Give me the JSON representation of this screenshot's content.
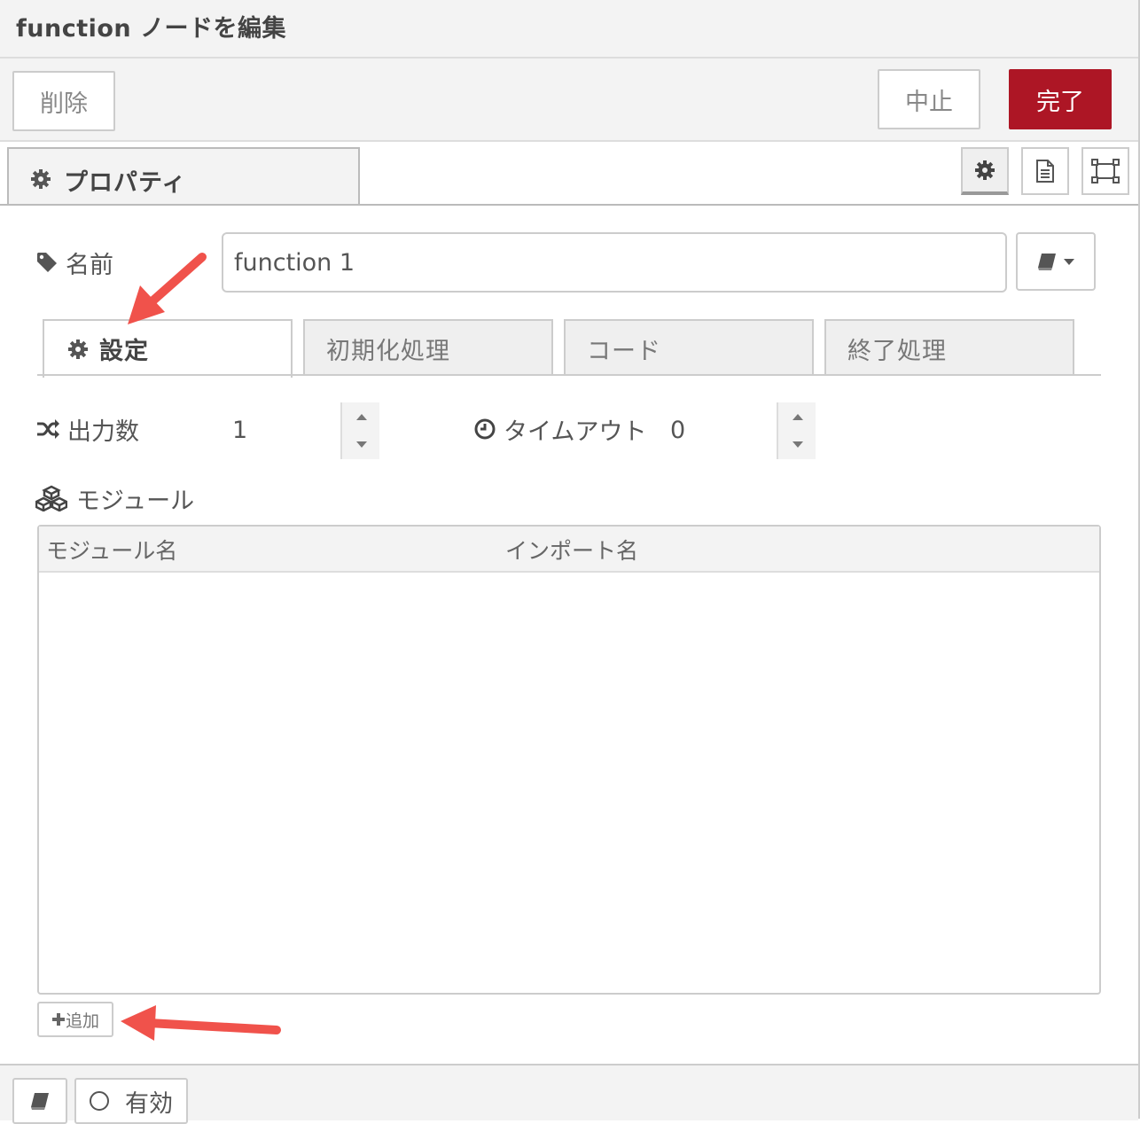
{
  "dialog": {
    "title": "function ノードを編集",
    "buttons": {
      "delete": "削除",
      "cancel": "中止",
      "done": "完了"
    }
  },
  "tray": {
    "tab_label": "プロパティ",
    "icons": [
      "gear-icon",
      "document-icon",
      "expand-icon"
    ]
  },
  "name_field": {
    "label": "名前",
    "value": "function 1"
  },
  "tabs": {
    "settings": "設定",
    "setup": "初期化処理",
    "code": "コード",
    "cleanup": "終了処理"
  },
  "outputs": {
    "label": "出力数",
    "value": "1"
  },
  "timeout": {
    "label": "タイムアウト",
    "value": "0"
  },
  "modules": {
    "label": "モジュール",
    "columns": [
      "モジュール名",
      "インポート名"
    ],
    "rows": [],
    "add_label": "追加"
  },
  "footer": {
    "enabled_label": "有効"
  },
  "colors": {
    "accent": "#ad1625",
    "annotation_arrow": "#f0524b"
  }
}
